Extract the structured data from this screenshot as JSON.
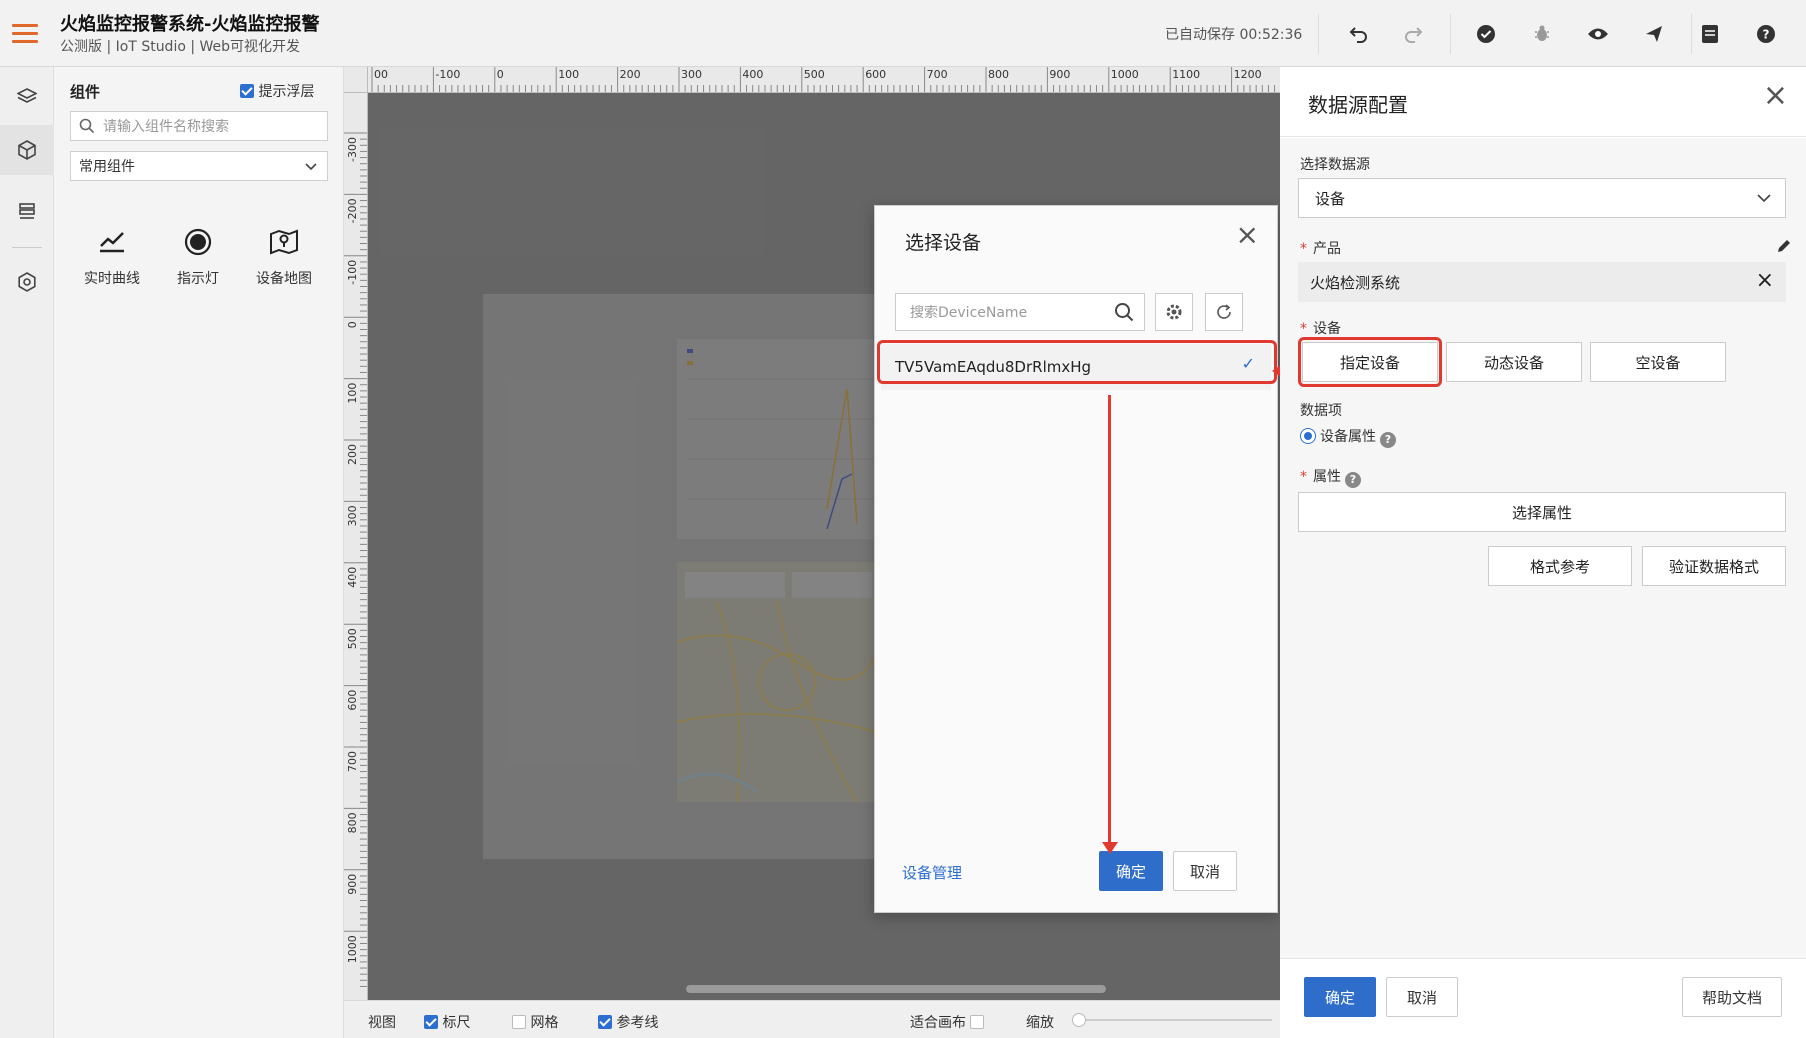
{
  "header": {
    "title": "火焰监控报警系统-火焰监控报警",
    "subtitle": "公测版 | IoT Studio | Web可视化开发",
    "autosave": "已自动保存 00:52:36"
  },
  "components_panel": {
    "title": "组件",
    "hint_label": "提示浮层",
    "search_placeholder": "请输入组件名称搜索",
    "category": "常用组件",
    "widgets": [
      {
        "label": "实时曲线",
        "icon": "trend-line-icon"
      },
      {
        "label": "指示灯",
        "icon": "indicator-light-icon"
      },
      {
        "label": "设备地图",
        "icon": "device-map-icon"
      }
    ]
  },
  "ruler": {
    "top_ticks": [
      "00",
      "-100",
      "0",
      "100",
      "200",
      "300",
      "400",
      "500",
      "600",
      "700",
      "800",
      "900",
      "1000",
      "1100",
      "1200"
    ],
    "left_ticks": [
      "-300",
      "-200",
      "-100",
      "0",
      "100",
      "200",
      "300",
      "400",
      "500",
      "600",
      "700",
      "800",
      "900",
      "1000"
    ]
  },
  "statusbar": {
    "view": "视图",
    "ruler": "标尺",
    "grid": "网格",
    "guides": "参考线",
    "fit": "适合画布",
    "zoom": "缩放"
  },
  "device_modal": {
    "title": "选择设备",
    "search_placeholder": "搜索DeviceName",
    "selected_device": "TV5VamEAqdu8DrRlmxHg",
    "manage_link": "设备管理",
    "ok": "确定",
    "cancel": "取消"
  },
  "datasource": {
    "title": "数据源配置",
    "source_label": "选择数据源",
    "source_value": "设备",
    "product_label": "产品",
    "product_value": "火焰检测系统",
    "device_label": "设备",
    "device_options": [
      "指定设备",
      "动态设备",
      "空设备"
    ],
    "data_item_label": "数据项",
    "data_item_option": "设备属性",
    "property_label": "属性",
    "property_button": "选择属性",
    "format_ref": "格式参考",
    "validate_format": "验证数据格式",
    "ok": "确定",
    "cancel": "取消",
    "help": "帮助文档"
  },
  "colors": {
    "primary": "#2e6dc9",
    "highlight": "#e03a30",
    "menu_icon": "#e06a2c"
  }
}
